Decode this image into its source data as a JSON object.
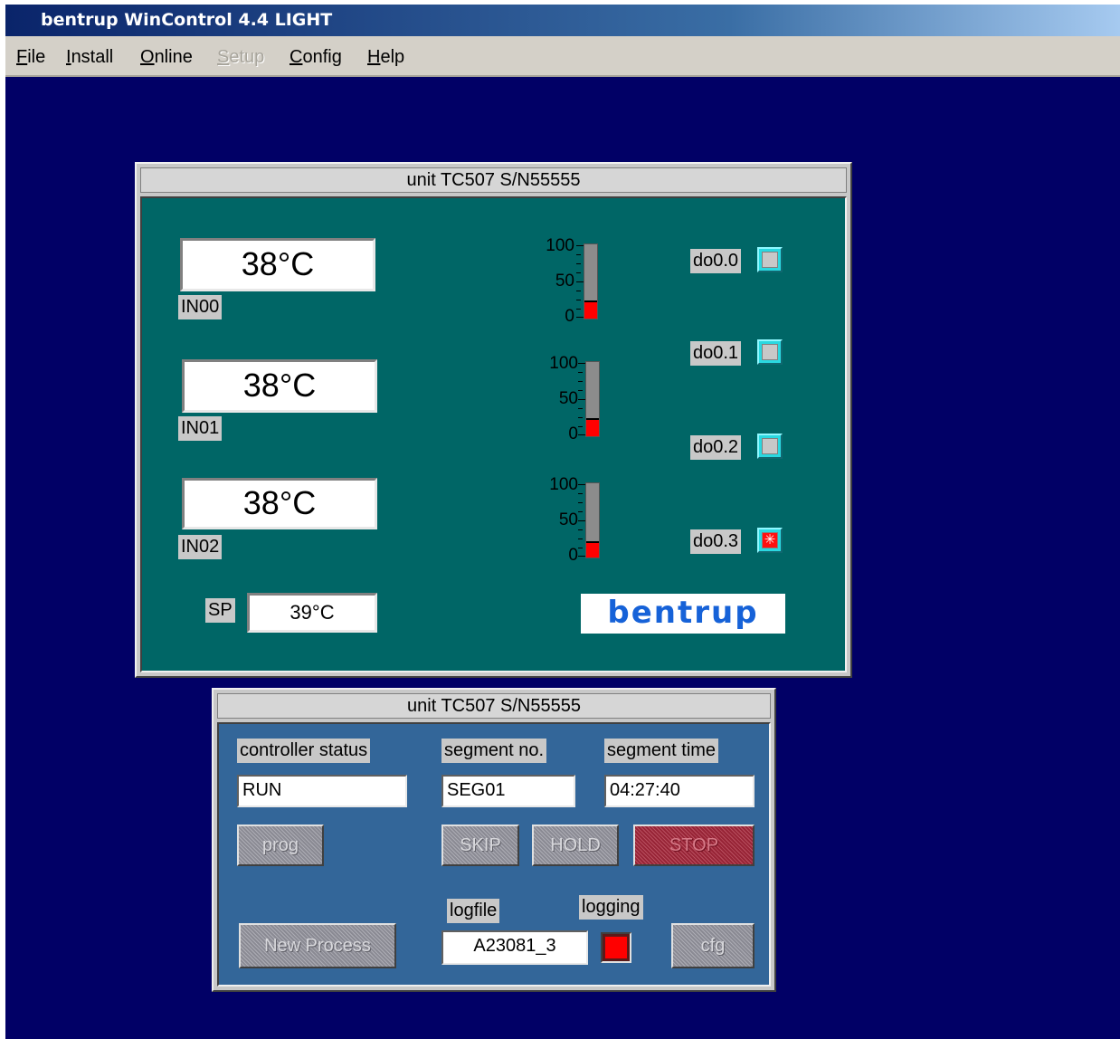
{
  "app": {
    "title": "bentrup WinControl 4.4 LIGHT",
    "menu": [
      {
        "label": "File",
        "accel": "F",
        "rest": "ile",
        "enabled": true
      },
      {
        "label": "Install",
        "accel": "I",
        "rest": "nstall",
        "enabled": true
      },
      {
        "label": "Online",
        "accel": "O",
        "rest": "nline",
        "enabled": true
      },
      {
        "label": "Setup",
        "accel": "S",
        "rest": "etup",
        "enabled": false
      },
      {
        "label": "Config",
        "accel": "C",
        "rest": "onfig",
        "enabled": true
      },
      {
        "label": "Help",
        "accel": "H",
        "rest": "elp",
        "enabled": true
      }
    ]
  },
  "unit_window": {
    "title": "unit TC507 S/N55555",
    "inputs": [
      {
        "label": "IN00",
        "value": "38°C"
      },
      {
        "label": "IN01",
        "value": "38°C"
      },
      {
        "label": "IN02",
        "value": "38°C"
      }
    ],
    "setpoint": {
      "label": "SP",
      "value": "39°C"
    },
    "bar_scale": {
      "max": "100",
      "mid": "50",
      "min": "0"
    },
    "bars": [
      {
        "fraction": 0.24
      },
      {
        "fraction": 0.24
      },
      {
        "fraction": 0.22
      }
    ],
    "outputs": [
      {
        "label": "do0.0",
        "state": "off"
      },
      {
        "label": "do0.1",
        "state": "off"
      },
      {
        "label": "do0.2",
        "state": "off"
      },
      {
        "label": "do0.3",
        "state": "on",
        "glyph": "✳"
      }
    ],
    "logo_text": "bentrup"
  },
  "control_window": {
    "title": "unit TC507 S/N55555",
    "controller_status": {
      "label": "controller status",
      "value": "RUN"
    },
    "segment_no": {
      "label": "segment no.",
      "value": "SEG01"
    },
    "segment_time": {
      "label": "segment time",
      "value": "04:27:40"
    },
    "buttons": {
      "prog": "prog",
      "skip": "SKIP",
      "hold": "HOLD",
      "stop": "STOP",
      "new_process": "New Process",
      "cfg": "cfg"
    },
    "logfile": {
      "label": "logfile",
      "value": "A23081_3"
    },
    "logging": {
      "label": "logging",
      "state": "on"
    }
  },
  "colors": {
    "desktop": "#010066",
    "unit_panel": "#006666",
    "control_panel": "#336699",
    "bar_fill": "#ff0000",
    "led_frame": "#2ad8e0"
  }
}
